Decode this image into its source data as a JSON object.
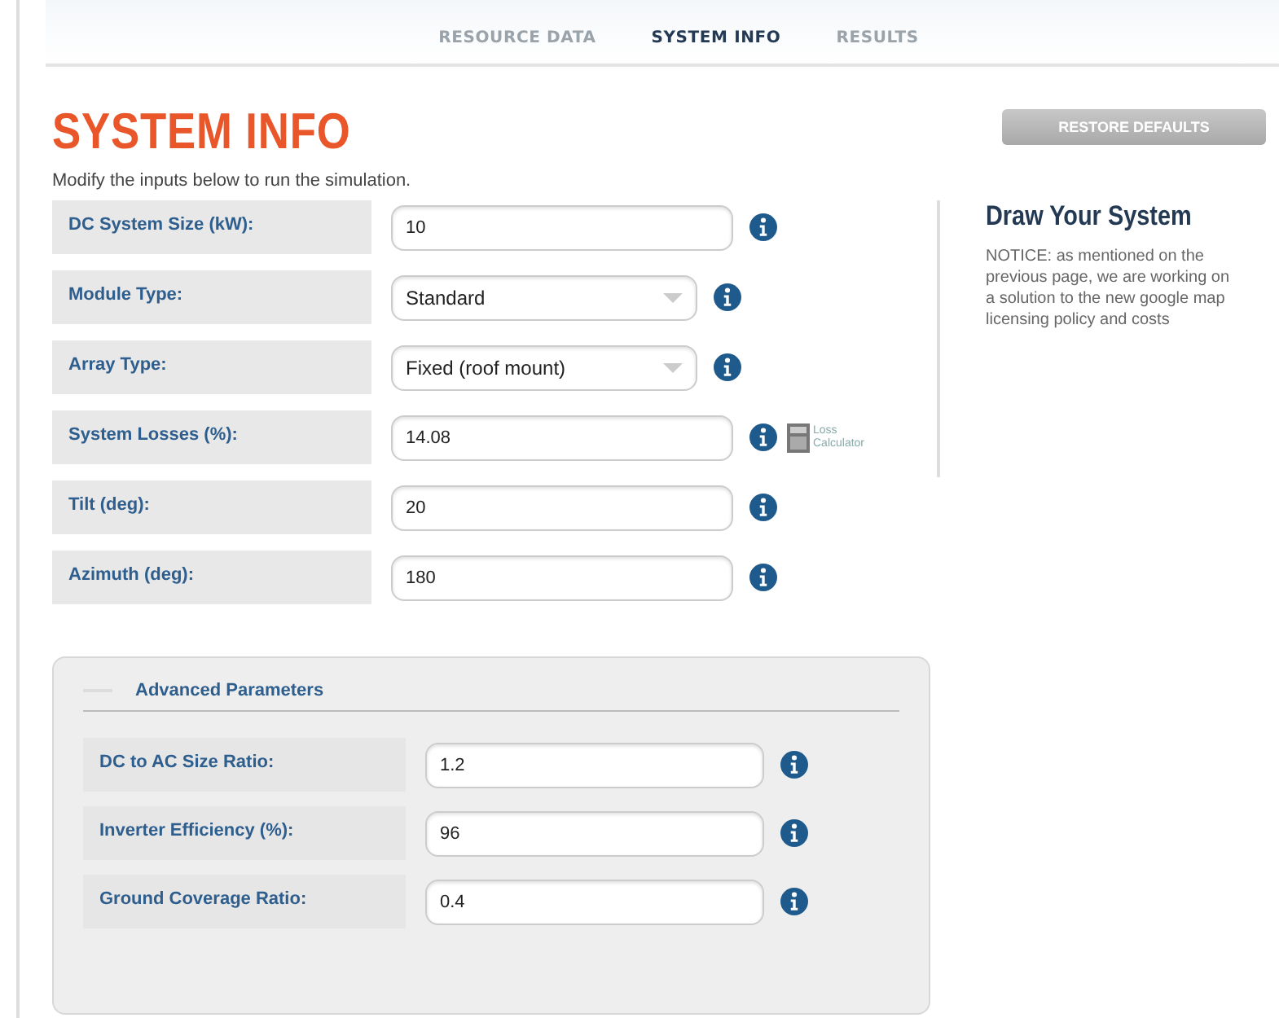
{
  "tabs": [
    {
      "label": "RESOURCE DATA",
      "selected": false
    },
    {
      "label": "SYSTEM INFO",
      "selected": true
    },
    {
      "label": "RESULTS",
      "selected": false
    }
  ],
  "title": "SYSTEM INFO",
  "restore_button": "RESTORE DEFAULTS",
  "intro": "Modify the inputs below to run the simulation.",
  "fields": [
    {
      "label": "DC System Size (kW):",
      "kind": "input",
      "value": "10"
    },
    {
      "label": "Module Type:",
      "kind": "select",
      "value": "Standard"
    },
    {
      "label": "Array Type:",
      "kind": "select",
      "value": "Fixed (roof mount)"
    },
    {
      "label": "System Losses (%):",
      "kind": "input",
      "value": "14.08",
      "extra": "Loss Calculator"
    },
    {
      "label": "Tilt (deg):",
      "kind": "input",
      "value": "20"
    },
    {
      "label": "Azimuth (deg):",
      "kind": "input",
      "value": "180"
    }
  ],
  "sidebar": {
    "title": "Draw Your System",
    "notice": "NOTICE: as mentioned on the previous page, we are working on a solution to the new google map licensing policy and costs"
  },
  "advanced": {
    "title": "Advanced Parameters",
    "fields": [
      {
        "label": "DC to AC Size Ratio:",
        "kind": "input",
        "value": "1.2"
      },
      {
        "label": "Inverter Efficiency (%):",
        "kind": "input",
        "value": "96"
      },
      {
        "label": "Ground Coverage Ratio:",
        "kind": "input",
        "value": "0.4"
      }
    ]
  }
}
